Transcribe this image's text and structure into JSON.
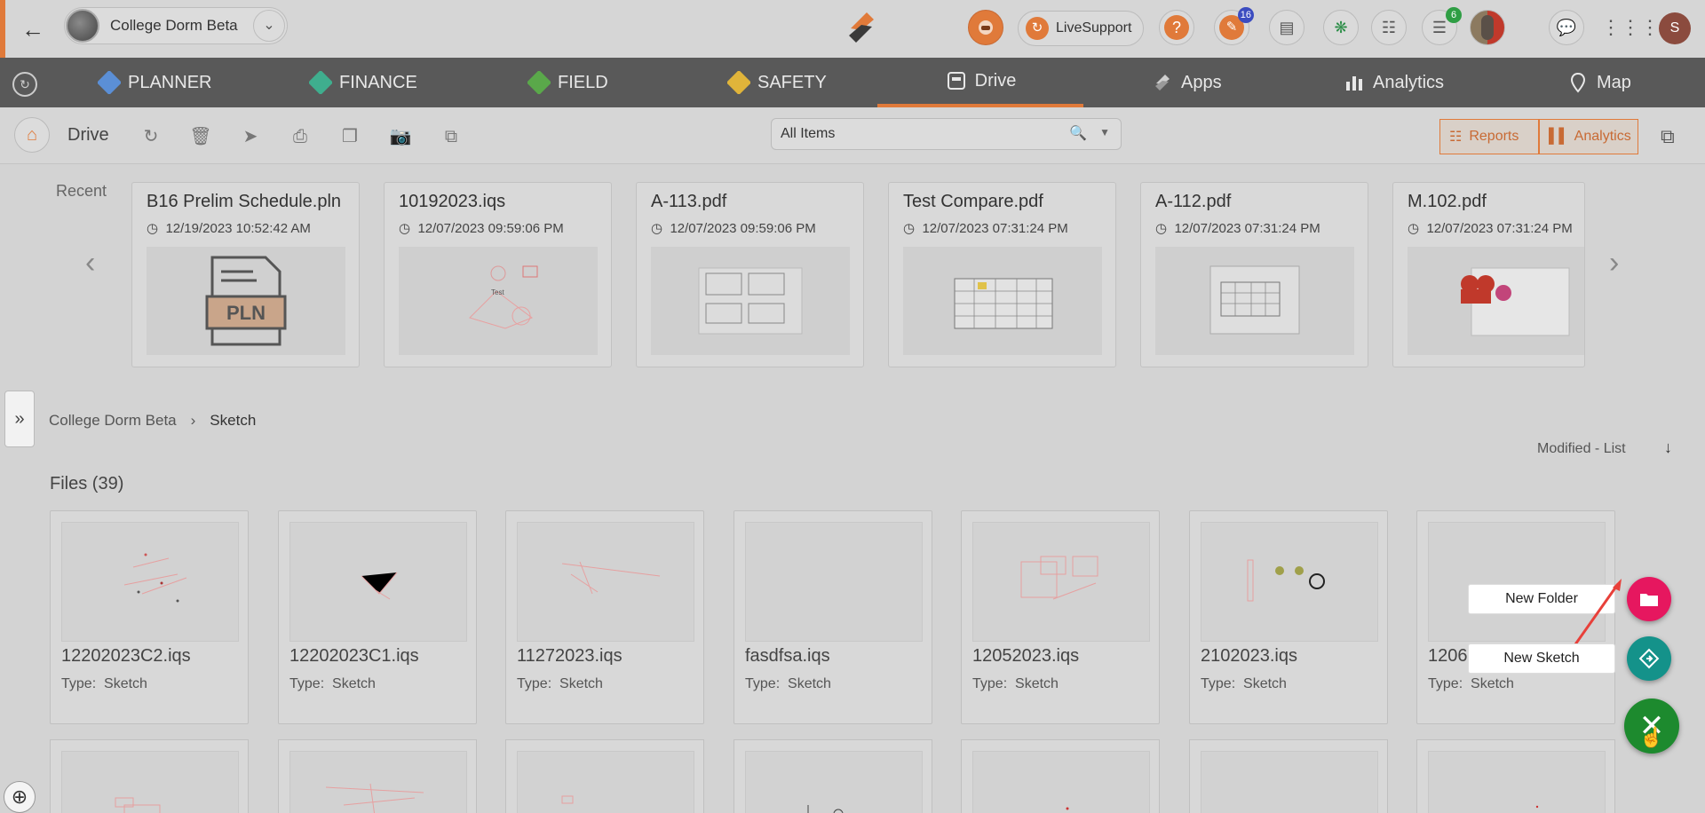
{
  "header": {
    "project_name": "College Dorm Beta",
    "live_support": "LiveSupport",
    "notif_badge": "16",
    "cart_badge": "6",
    "user_initial": "S"
  },
  "nav": {
    "items": [
      {
        "label": "PLANNER"
      },
      {
        "label": "FINANCE"
      },
      {
        "label": "FIELD"
      },
      {
        "label": "SAFETY"
      },
      {
        "label": "Drive"
      },
      {
        "label": "Apps"
      },
      {
        "label": "Analytics"
      },
      {
        "label": "Map"
      }
    ]
  },
  "toolbar": {
    "title": "Drive",
    "filter_value": "All Items",
    "reports_label": "Reports",
    "analytics_label": "Analytics"
  },
  "recent": {
    "label": "Recent",
    "items": [
      {
        "title": "B16 Prelim Schedule.pln",
        "date": "12/19/2023 10:52:42 AM"
      },
      {
        "title": "10192023.iqs",
        "date": "12/07/2023 09:59:06 PM"
      },
      {
        "title": "A-113.pdf",
        "date": "12/07/2023 09:59:06 PM"
      },
      {
        "title": "Test Compare.pdf",
        "date": "12/07/2023 07:31:24 PM"
      },
      {
        "title": "A-112.pdf",
        "date": "12/07/2023 07:31:24 PM"
      },
      {
        "title": "M.102.pdf",
        "date": "12/07/2023 07:31:24 PM"
      }
    ],
    "pln_badge": "PLN",
    "sketch_text": "Test"
  },
  "breadcrumb": {
    "root": "College Dorm Beta",
    "current": "Sketch"
  },
  "sort_label": "Modified - List",
  "files": {
    "heading": "Files (39)",
    "type_label": "Type:",
    "items": [
      {
        "name": "12202023C2.iqs",
        "type": "Sketch"
      },
      {
        "name": "12202023C1.iqs",
        "type": "Sketch"
      },
      {
        "name": "11272023.iqs",
        "type": "Sketch"
      },
      {
        "name": "fasdfsa.iqs",
        "type": "Sketch"
      },
      {
        "name": "12052023.iqs",
        "type": "Sketch"
      },
      {
        "name": "2102023.iqs",
        "type": "Sketch"
      },
      {
        "name": "1206",
        "type": "Sketch"
      }
    ]
  },
  "fab": {
    "new_folder": "New Folder",
    "new_sketch": "New Sketch"
  },
  "colors": {
    "accent": "#e07a3a",
    "fab_pink": "#e6175f",
    "fab_teal": "#14928a",
    "fab_green": "#1d8a2e"
  }
}
